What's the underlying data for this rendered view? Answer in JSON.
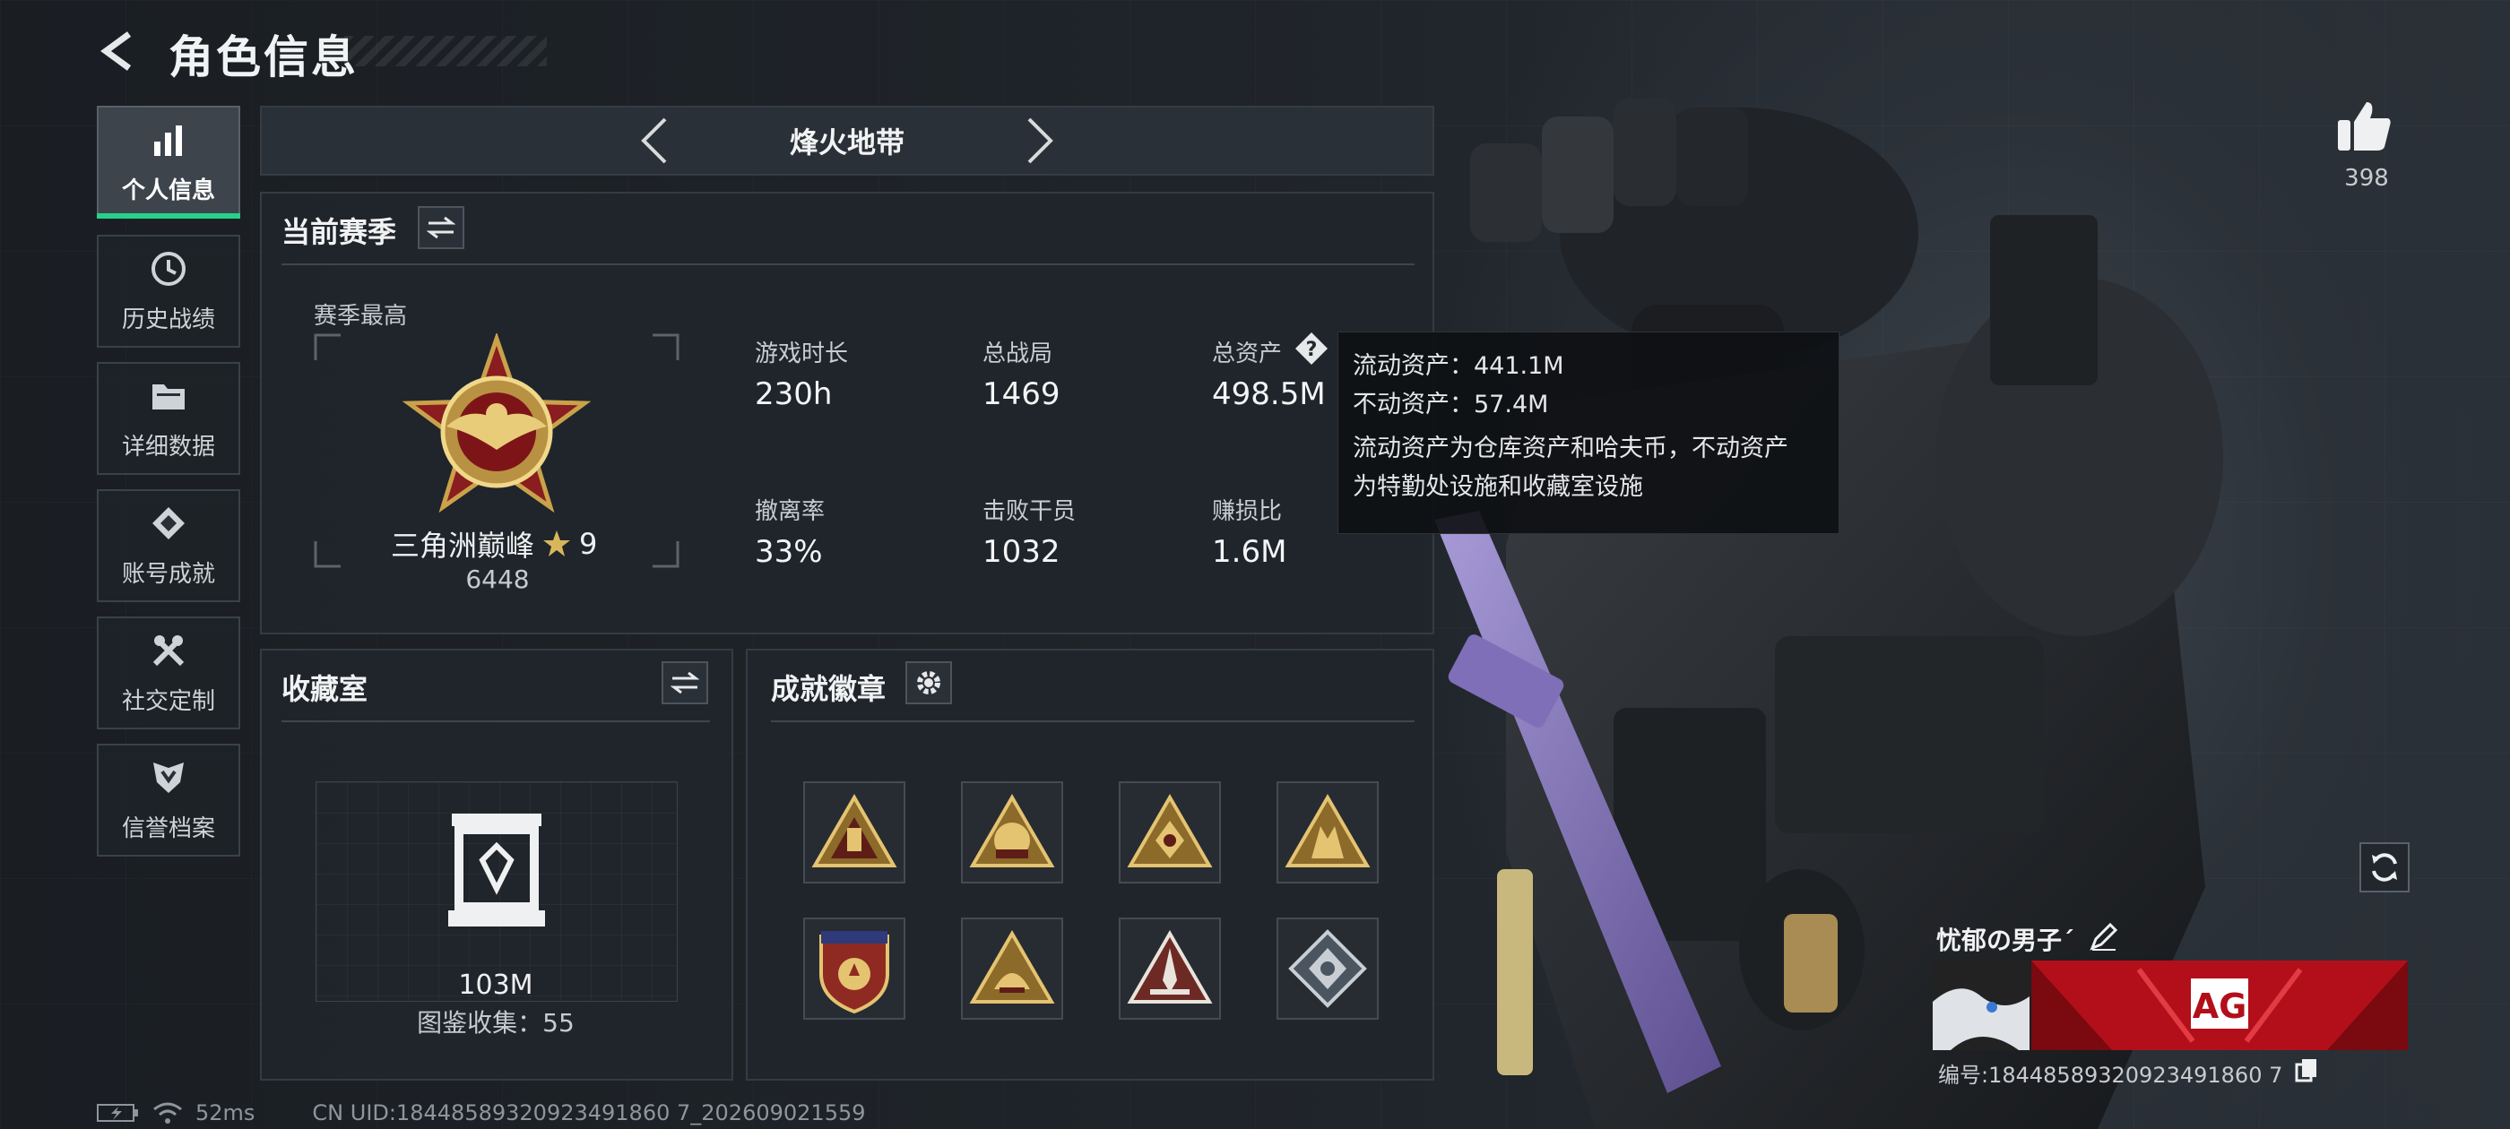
{
  "header": {
    "title": "角色信息"
  },
  "sidebar": {
    "items": [
      {
        "label": "个人信息",
        "icon": "bar-chart-icon",
        "active": true
      },
      {
        "label": "历史战绩",
        "icon": "clock-icon",
        "active": false
      },
      {
        "label": "详细数据",
        "icon": "folder-icon",
        "active": false
      },
      {
        "label": "账号成就",
        "icon": "achievement-icon",
        "active": false
      },
      {
        "label": "社交定制",
        "icon": "tools-icon",
        "active": false
      },
      {
        "label": "信誉档案",
        "icon": "shield-icon",
        "active": false
      }
    ]
  },
  "mode": {
    "name": "烽火地带"
  },
  "season": {
    "title": "当前赛季",
    "best_label": "赛季最高",
    "rank_name": "三角洲巅峰",
    "rank_stars": "9",
    "rank_points": "6448",
    "stats": [
      {
        "label": "游戏时长",
        "value": "230h"
      },
      {
        "label": "总战局",
        "value": "1469"
      },
      {
        "label": "总资产",
        "value": "498.5M"
      },
      {
        "label": "撤离率",
        "value": "33%"
      },
      {
        "label": "击败干员",
        "value": "1032"
      },
      {
        "label": "赚损比",
        "value": "1.6M"
      }
    ]
  },
  "tooltip": {
    "line1": "流动资产：441.1M",
    "line2": "不动资产：57.4M",
    "line3": "流动资产为仓库资产和哈夫币，不动资产",
    "line4": "为特勤处设施和收藏室设施"
  },
  "collection": {
    "title": "收藏室",
    "value": "103M",
    "count_text": "图鉴收集：55"
  },
  "achievements": {
    "title": "成就徽章",
    "badges": [
      "badge-1",
      "badge-2",
      "badge-3",
      "badge-4",
      "badge-5",
      "badge-6",
      "badge-7",
      "badge-8"
    ]
  },
  "likes": {
    "count": "398"
  },
  "player": {
    "name": "忧郁の男子´",
    "id_text": "编号:18448589320923491860 7"
  },
  "status_bar": {
    "ping": "52ms",
    "uid": "CN UID:18448589320923491860 7_202609021559"
  },
  "colors": {
    "accent_green": "#27d08a",
    "gold": "#c9a24a",
    "banner_red": "#c4121c"
  }
}
